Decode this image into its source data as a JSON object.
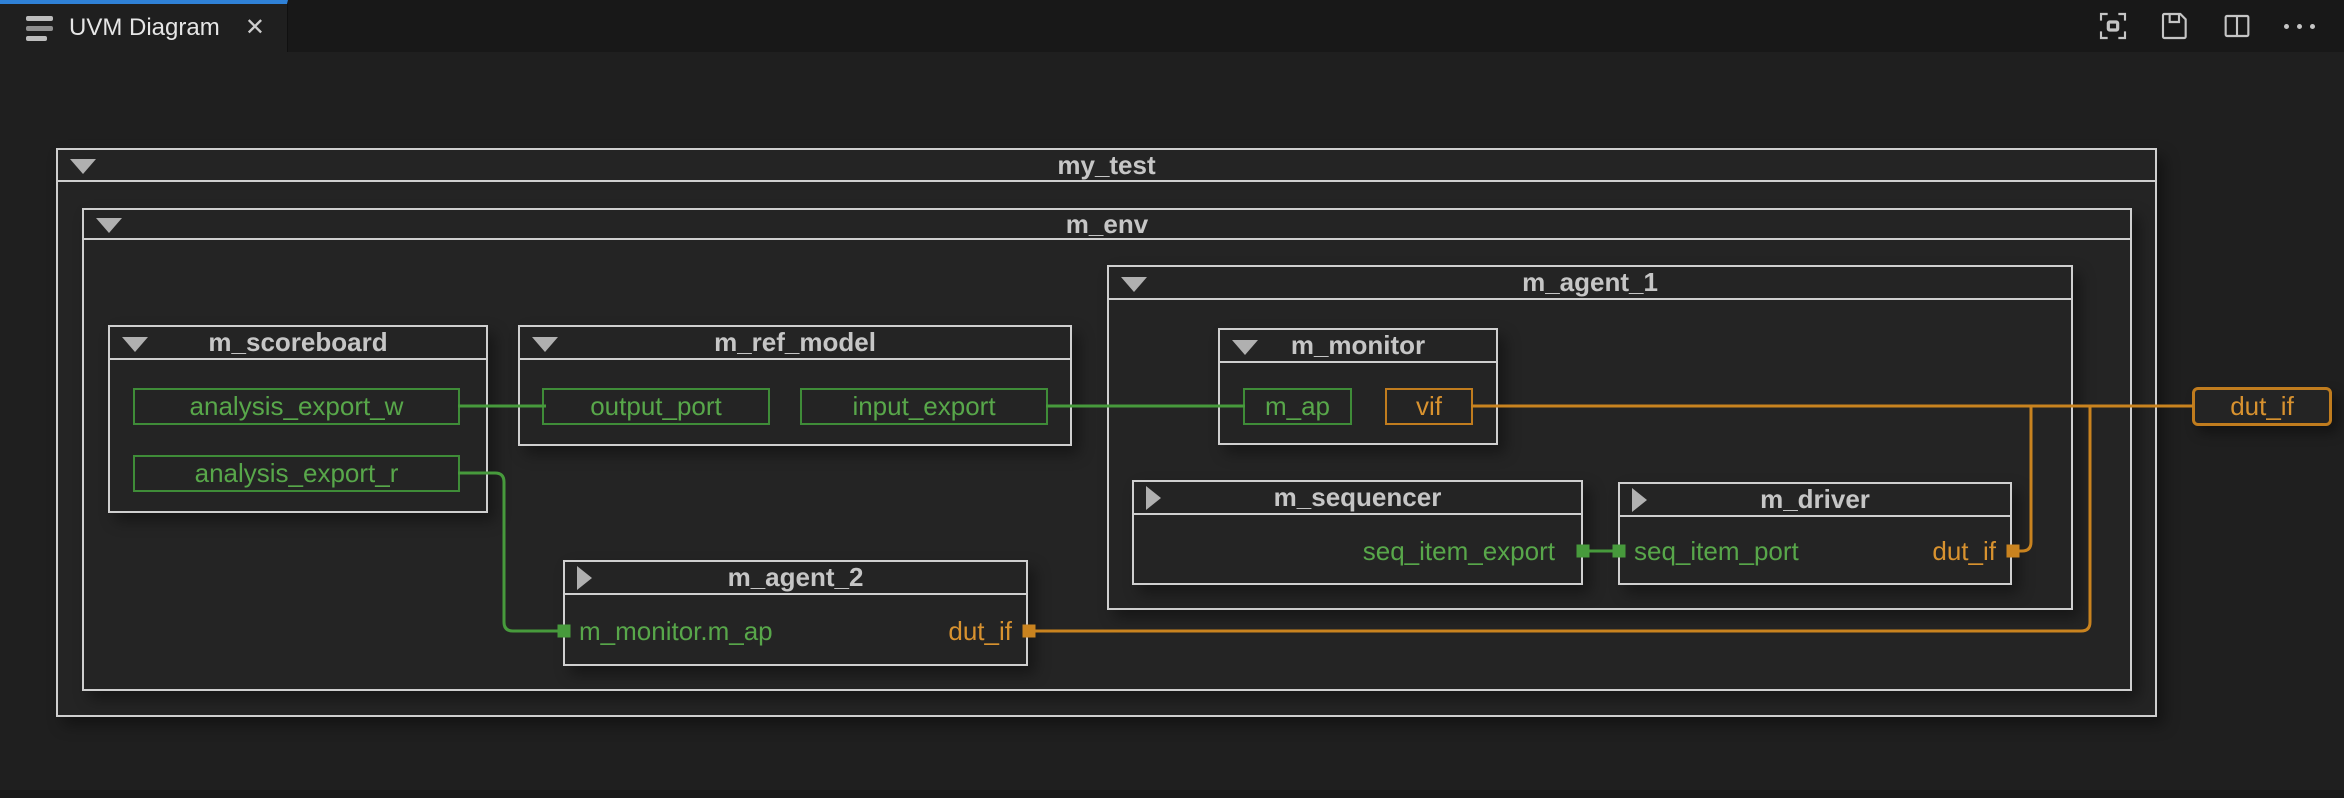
{
  "window": {
    "tab": {
      "title": "UVM Diagram",
      "close": "✕"
    },
    "actions": {
      "fit_to_screen": "fit-to-screen",
      "save": "save",
      "split_editor": "split-editor",
      "more": "more-actions"
    }
  },
  "diagram": {
    "my_test": {
      "title": "my_test",
      "collapsed": false
    },
    "m_env": {
      "title": "m_env",
      "collapsed": false
    },
    "m_scoreboard": {
      "title": "m_scoreboard",
      "collapsed": false,
      "ports": {
        "analysis_export_w": "analysis_export_w",
        "analysis_export_r": "analysis_export_r"
      }
    },
    "m_ref_model": {
      "title": "m_ref_model",
      "collapsed": false,
      "ports": {
        "output_port": "output_port",
        "input_export": "input_export"
      }
    },
    "m_agent_1": {
      "title": "m_agent_1",
      "collapsed": false
    },
    "m_monitor": {
      "title": "m_monitor",
      "collapsed": false,
      "ports": {
        "m_ap": "m_ap",
        "vif": "vif"
      }
    },
    "m_sequencer": {
      "title": "m_sequencer",
      "collapsed": true,
      "ports": {
        "seq_item_export": "seq_item_export"
      }
    },
    "m_driver": {
      "title": "m_driver",
      "collapsed": true,
      "ports": {
        "seq_item_port": "seq_item_port",
        "dut_if": "dut_if"
      }
    },
    "m_agent_2": {
      "title": "m_agent_2",
      "collapsed": true,
      "ports": {
        "m_monitor_m_ap": "m_monitor.m_ap",
        "dut_if": "dut_if"
      }
    },
    "external": {
      "dut_if": "dut_if"
    }
  },
  "colors": {
    "background": "#1f1f1f",
    "tab_accent": "#2f81d7",
    "box_border": "#cfcfcf",
    "green_wire": "#479a3c",
    "green_text": "#58a74a",
    "orange_wire": "#c9831f",
    "orange_text": "#d8922f"
  }
}
